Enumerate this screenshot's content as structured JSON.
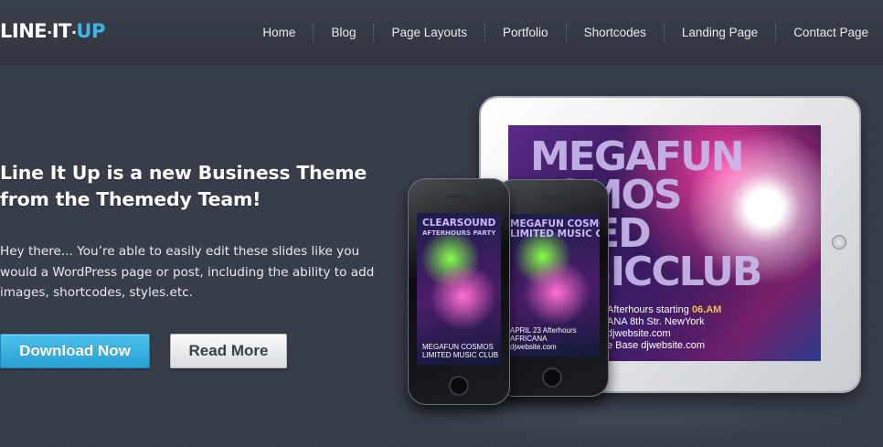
{
  "header": {
    "logo": {
      "part1": "LINE",
      "part2": "IT",
      "part3": "UP",
      "sep": "·",
      "accent_color": "#3db5e6"
    },
    "nav": [
      "Home",
      "Blog",
      "Page Layouts",
      "Portfolio",
      "Shortcodes",
      "Landing Page",
      "Contact Page"
    ]
  },
  "hero": {
    "headline_line1": "Line It Up is a new Business Theme",
    "headline_line2": "from the Themedy Team!",
    "body_line1": "Hey there... You’re able to easily edit these slides like you",
    "body_line2": "would a WordPress page or post, including the ability to add",
    "body_line3": "images, shortcodes, styles.etc.",
    "download_button": "Download Now",
    "read_more_button": "Read More"
  },
  "devices": {
    "tablet_title_line1": "MEGAFUN",
    "tablet_title_line2": "SMOS",
    "tablet_title_line3": "TED",
    "tablet_title_line4": "SICCLUB",
    "tablet_info_line1": "Afterhours starting",
    "tablet_info_time": "06.AM",
    "tablet_info_line2": "ANA 8th Str. NewYork",
    "tablet_info_line3": "djwebsite.com",
    "tablet_info_line4": "e Base djwebsite.com",
    "phone1_title_line1": "CLEARSOUND",
    "phone1_title_line2": "AFTERHOURS PARTY",
    "phone1_title_line3": "MEGAFUN COSMOS",
    "phone1_title_line4": "LIMITED MUSIC CLUB",
    "phone2_title_line1": "MEGAFUN COSMOS",
    "phone2_title_line2": "LIMITED MUSIC CLUB",
    "phone2_sub_line1": "APRIL 23 Afterhours",
    "phone2_sub_line2": "AFRICANA",
    "phone2_sub_line3": "djwebsite.com"
  }
}
